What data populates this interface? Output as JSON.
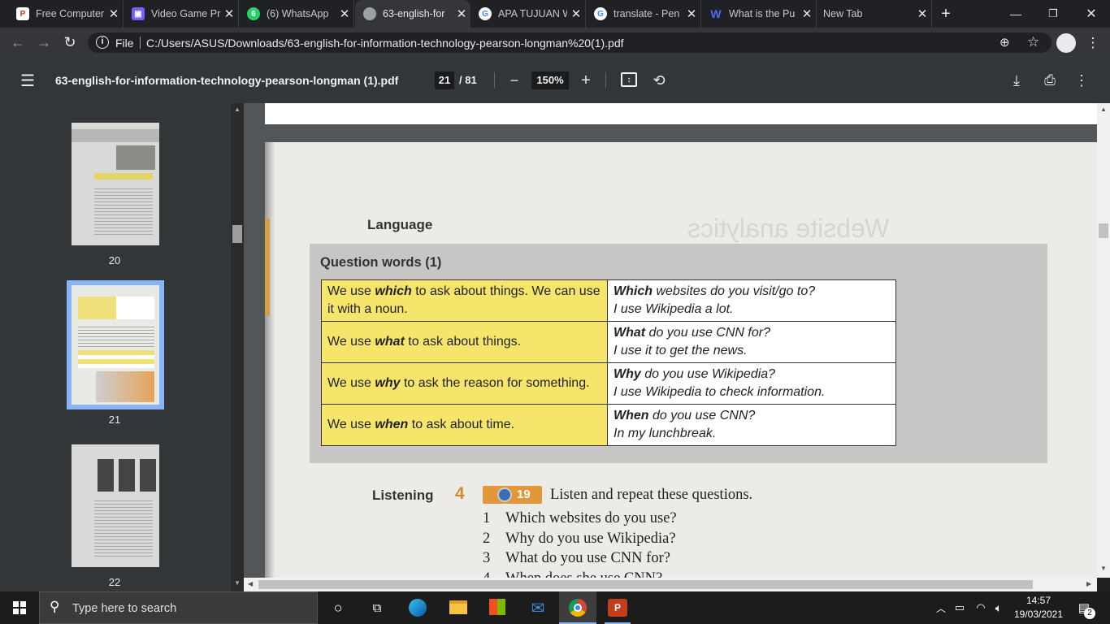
{
  "tabs": [
    {
      "title": "Free Computer",
      "fav": "P",
      "color": "#e8eaed",
      "fcolor": "#c0392b"
    },
    {
      "title": "Video Game Pr",
      "fav": "",
      "color": "#7b5cff"
    },
    {
      "title": "(6) WhatsApp",
      "fav": "6",
      "color": "#25d366"
    },
    {
      "title": "63-english-for",
      "fav": "",
      "color": "#9aa0a6"
    },
    {
      "title": "APA TUJUAN W",
      "fav": "G",
      "color": "#ffffff"
    },
    {
      "title": "translate - Pen",
      "fav": "G",
      "color": "#ffffff"
    },
    {
      "title": "What is the Pu",
      "fav": "",
      "color": "#4a6cf7"
    },
    {
      "title": "New Tab",
      "fav": "",
      "color": ""
    }
  ],
  "address": {
    "scheme": "File",
    "url": "C:/Users/ASUS/Downloads/63-english-for-information-technology-pearson-longman%20(1).pdf"
  },
  "pdf": {
    "filename": "63-english-for-information-technology-pearson-longman (1).pdf",
    "page": "21",
    "total": "/ 81",
    "zoom": "150%"
  },
  "thumbs": [
    "20",
    "21",
    "22"
  ],
  "page": {
    "section": "Language",
    "heading": "Question words (1)",
    "rows": [
      {
        "pre": "We use ",
        "word": "which",
        "post": " to ask about things. We can use it with a noun.",
        "qw": "Which",
        "q": " websites do you visit/go to?",
        "a": "I use Wikipedia a lot."
      },
      {
        "pre": "We use ",
        "word": "what",
        "post": " to ask about things.",
        "qw": "What",
        "q": " do you use CNN for?",
        "a": "I use it to get the news."
      },
      {
        "pre": "We use ",
        "word": "why",
        "post": " to ask the reason for something.",
        "qw": "Why",
        "q": " do you use Wikipedia?",
        "a": "I use Wikipedia to check information."
      },
      {
        "pre": "We use ",
        "word": "when",
        "post": " to ask about time.",
        "qw": "When",
        "q": " do you use CNN?",
        "a": "In my lunchbreak."
      }
    ],
    "listening": {
      "label": "Listening",
      "num": "4",
      "track": "19",
      "instruction": "Listen and repeat these questions.",
      "items": [
        {
          "n": "1",
          "t": "Which websites do you use?"
        },
        {
          "n": "2",
          "t": "Why do you use Wikipedia?"
        },
        {
          "n": "3",
          "t": "What do you use CNN for?"
        },
        {
          "n": "4",
          "t": "When does she use CNN?"
        }
      ]
    },
    "ghost_title": "Website analytics"
  },
  "taskbar": {
    "search": "Type here to search",
    "time": "14:57",
    "date": "19/03/2021",
    "notif": "2"
  }
}
